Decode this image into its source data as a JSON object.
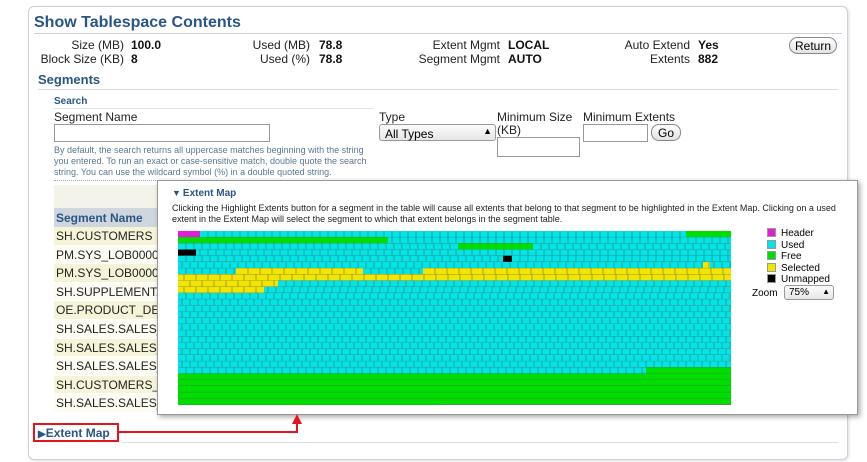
{
  "page": {
    "title": "Show Tablespace Contents",
    "return_label": "Return"
  },
  "summary": {
    "size_mb_label": "Size (MB)",
    "size_mb": "100.0",
    "block_size_label": "Block Size (KB)",
    "block_size": "8",
    "used_mb_label": "Used (MB)",
    "used_mb": "78.8",
    "used_pct_label": "Used (%)",
    "used_pct": "78.8",
    "extent_mgmt_label": "Extent Mgmt",
    "extent_mgmt": "LOCAL",
    "segment_mgmt_label": "Segment Mgmt",
    "segment_mgmt": "AUTO",
    "auto_extend_label": "Auto Extend",
    "auto_extend": "Yes",
    "extents_label": "Extents",
    "extents": "882"
  },
  "segments": {
    "title": "Segments",
    "search": {
      "heading": "Search",
      "segment_name_label": "Segment Name",
      "segment_name_value": "",
      "type_label": "Type",
      "type_value": "All Types",
      "min_size_label": "Minimum Size",
      "min_size_unit": "(KB)",
      "min_size_value": "",
      "min_extents_label": "Minimum Extents",
      "min_extents_value": "",
      "go_label": "Go",
      "hint": "By default, the search returns all uppercase matches beginning with the string you entered. To run an exact or case-sensitive match, double quote the search string. You can use the wildcard symbol (%) in a double quoted string."
    },
    "table": {
      "column_header": "Segment Name",
      "rows": [
        "SH.CUSTOMERS",
        "PM.SYS_LOB0000",
        "PM.SYS_LOB0000",
        "SH.SUPPLEMENTAI",
        "OE.PRODUCT_DES",
        "SH.SALES.SALES_",
        "SH.SALES.SALES_",
        "SH.SALES.SALES_",
        "SH.CUSTOMERS_F",
        "SH.SALES.SALES_"
      ]
    }
  },
  "extent_map": {
    "title": "Extent Map",
    "description": "Clicking the Highlight Extents button for a segment in the table will cause all extents that belong to that segment to be highlighted in the Extent Map. Clicking on a used extent in the Extent Map will select the segment to which that extent belongs in the segment table.",
    "legend": [
      {
        "label": "Header",
        "color": "#e020d8"
      },
      {
        "label": "Used",
        "color": "#00e5e5"
      },
      {
        "label": "Free",
        "color": "#00dd00"
      },
      {
        "label": "Selected",
        "color": "#f2e600"
      },
      {
        "label": "Unmapped",
        "color": "#000000"
      }
    ],
    "zoom_label": "Zoom",
    "zoom_value": "75%",
    "grid_color": "#555555"
  },
  "collapsed_section": {
    "title": "Extent Map"
  }
}
